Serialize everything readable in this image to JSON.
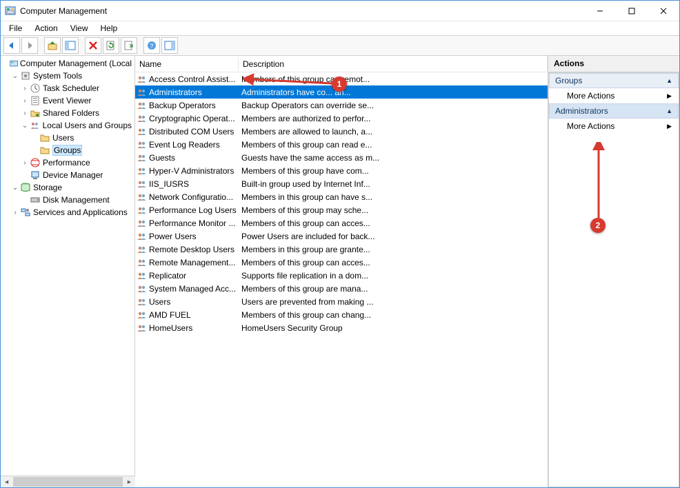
{
  "window": {
    "title": "Computer Management"
  },
  "menu": {
    "file": "File",
    "action": "Action",
    "view": "View",
    "help": "Help"
  },
  "tree": {
    "root": "Computer Management (Local",
    "system_tools": "System Tools",
    "task_scheduler": "Task Scheduler",
    "event_viewer": "Event Viewer",
    "shared_folders": "Shared Folders",
    "local_users_groups": "Local Users and Groups",
    "users": "Users",
    "groups": "Groups",
    "performance": "Performance",
    "device_manager": "Device Manager",
    "storage": "Storage",
    "disk_management": "Disk Management",
    "services_apps": "Services and Applications"
  },
  "list": {
    "col_name": "Name",
    "col_desc": "Description",
    "rows": [
      {
        "name": "Access Control Assist...",
        "desc": "Members of this group can remot..."
      },
      {
        "name": "Administrators",
        "desc": "Administrators have co...      an..."
      },
      {
        "name": "Backup Operators",
        "desc": "Backup Operators can override se..."
      },
      {
        "name": "Cryptographic Operat...",
        "desc": "Members are authorized to perfor..."
      },
      {
        "name": "Distributed COM Users",
        "desc": "Members are allowed to launch, a..."
      },
      {
        "name": "Event Log Readers",
        "desc": "Members of this group can read e..."
      },
      {
        "name": "Guests",
        "desc": "Guests have the same access as m..."
      },
      {
        "name": "Hyper-V Administrators",
        "desc": "Members of this group have com..."
      },
      {
        "name": "IIS_IUSRS",
        "desc": "Built-in group used by Internet Inf..."
      },
      {
        "name": "Network Configuratio...",
        "desc": "Members in this group can have s..."
      },
      {
        "name": "Performance Log Users",
        "desc": "Members of this group may sche..."
      },
      {
        "name": "Performance Monitor ...",
        "desc": "Members of this group can acces..."
      },
      {
        "name": "Power Users",
        "desc": "Power Users are included for back..."
      },
      {
        "name": "Remote Desktop Users",
        "desc": "Members in this group are grante..."
      },
      {
        "name": "Remote Management...",
        "desc": "Members of this group can acces..."
      },
      {
        "name": "Replicator",
        "desc": "Supports file replication in a dom..."
      },
      {
        "name": "System Managed Acc...",
        "desc": "Members of this group are mana..."
      },
      {
        "name": "Users",
        "desc": "Users are prevented from making ..."
      },
      {
        "name": "AMD FUEL",
        "desc": "Members of this group can chang..."
      },
      {
        "name": "HomeUsers",
        "desc": "HomeUsers Security Group"
      }
    ]
  },
  "actions": {
    "header": "Actions",
    "groups": "Groups",
    "administrators": "Administrators",
    "more_actions": "More Actions"
  },
  "annotations": {
    "a1": "1",
    "a2": "2"
  }
}
